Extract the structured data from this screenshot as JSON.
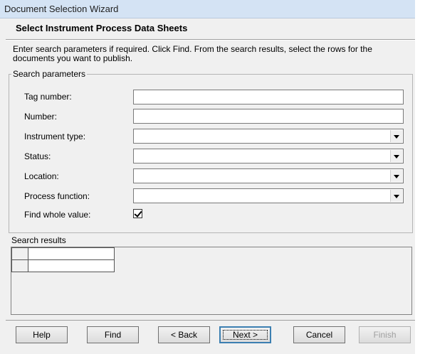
{
  "window": {
    "title": "Document Selection Wizard"
  },
  "header": {
    "title": "Select Instrument Process Data Sheets",
    "instructions": "Enter search parameters if required. Click Find. From the search results, select the rows for the documents you want to publish."
  },
  "search_parameters": {
    "legend": "Search parameters",
    "fields": [
      {
        "label": "Tag number:",
        "type": "text",
        "value": ""
      },
      {
        "label": "Number:",
        "type": "text",
        "value": ""
      },
      {
        "label": "Instrument type:",
        "type": "combo",
        "value": ""
      },
      {
        "label": "Status:",
        "type": "combo",
        "value": ""
      },
      {
        "label": "Location:",
        "type": "combo",
        "value": ""
      },
      {
        "label": "Process function:",
        "type": "combo",
        "value": ""
      }
    ],
    "find_whole_value": {
      "label": "Find whole value:",
      "checked": true
    }
  },
  "search_results": {
    "label": "Search results"
  },
  "buttons": {
    "help": "Help",
    "find": "Find",
    "back": "< Back",
    "next": "Next >",
    "cancel": "Cancel",
    "finish": "Finish"
  }
}
